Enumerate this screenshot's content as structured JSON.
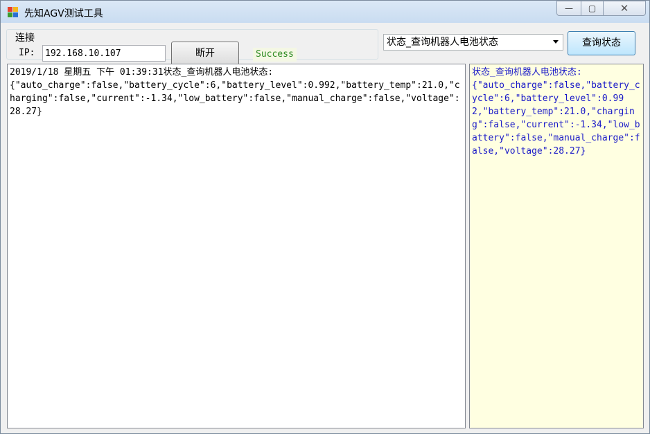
{
  "window": {
    "title": "先知AGV测试工具",
    "controls": {
      "minimize": "—",
      "maximize": "▢",
      "close": "✕"
    }
  },
  "connection": {
    "group_label": "连接",
    "ip_label": "IP:",
    "ip_value": "192.168.10.107",
    "disconnect_label": "断开",
    "status_text": "Success",
    "status_color": "#2e8b22"
  },
  "query": {
    "selected_command": "状态_查询机器人电池状态",
    "button_label": "查询状态"
  },
  "log": {
    "header": "2019/1/18 星期五 下午 01:39:31状态_查询机器人电池状态:",
    "body": "{\"auto_charge\":false,\"battery_cycle\":6,\"battery_level\":0.992,\"battery_temp\":21.0,\"charging\":false,\"current\":-1.34,\"low_battery\":false,\"manual_charge\":false,\"voltage\":28.27}"
  },
  "result": {
    "header": "状态_查询机器人电池状态:",
    "body": "{\"auto_charge\":false,\"battery_cycle\":6,\"battery_level\":0.992,\"battery_temp\":21.0,\"charging\":false,\"current\":-1.34,\"low_battery\":false,\"manual_charge\":false,\"voltage\":28.27}",
    "background": "#ffffe1",
    "text_color": "#1a1ac8"
  }
}
